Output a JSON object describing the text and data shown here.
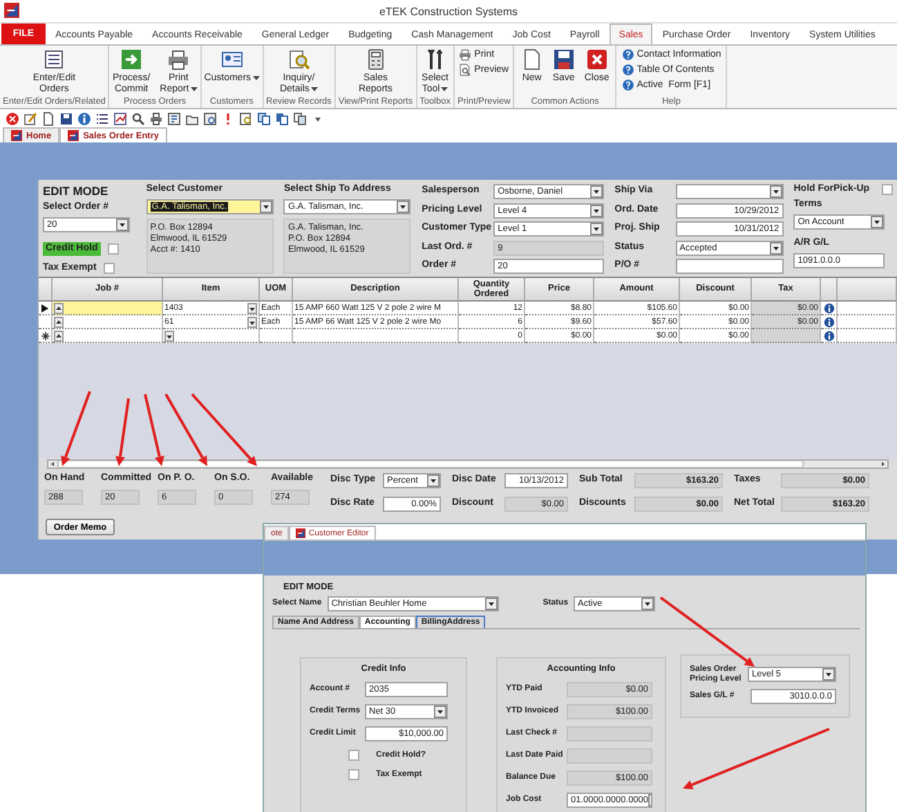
{
  "window": {
    "title": "eTEK Construction Systems"
  },
  "menu_tabs": [
    {
      "label": "FILE",
      "kind": "file",
      "selected": false
    },
    {
      "label": "Accounts Payable",
      "kind": "tab",
      "selected": false
    },
    {
      "label": "Accounts Receivable",
      "kind": "tab",
      "selected": false
    },
    {
      "label": "General Ledger",
      "kind": "tab",
      "selected": false
    },
    {
      "label": "Budgeting",
      "kind": "tab",
      "selected": false
    },
    {
      "label": "Cash Management",
      "kind": "tab",
      "selected": false
    },
    {
      "label": "Job Cost",
      "kind": "tab",
      "selected": false
    },
    {
      "label": "Payroll",
      "kind": "tab",
      "selected": false
    },
    {
      "label": "Sales",
      "kind": "tab",
      "selected": true
    },
    {
      "label": "Purchase Order",
      "kind": "tab",
      "selected": false
    },
    {
      "label": "Inventory",
      "kind": "tab",
      "selected": false
    },
    {
      "label": "System Utilities",
      "kind": "tab",
      "selected": false
    }
  ],
  "ribbon_groups": [
    {
      "label": "Enter/Edit Orders/Related",
      "buttons": [
        {
          "label": "Enter/Edit\nOrders",
          "kind": "large",
          "dropdown": false
        }
      ]
    },
    {
      "label": "Process Orders",
      "buttons": [
        {
          "label": "Process/\nCommit",
          "kind": "large",
          "dropdown": false
        },
        {
          "label": "Print\nReport",
          "kind": "large",
          "dropdown": true
        }
      ]
    },
    {
      "label": "Customers",
      "buttons": [
        {
          "label": "Customers",
          "kind": "large",
          "dropdown": true
        }
      ]
    },
    {
      "label": "Review Records",
      "buttons": [
        {
          "label": "Inquiry/\nDetails",
          "kind": "large",
          "dropdown": true
        }
      ]
    },
    {
      "label": "View/Print Reports",
      "buttons": [
        {
          "label": "Sales\nReports",
          "kind": "large",
          "dropdown": false
        }
      ]
    },
    {
      "label": "Toolbox",
      "buttons": [
        {
          "label": "Select\nTool",
          "kind": "large",
          "dropdown": true
        }
      ]
    },
    {
      "label": "Print/Preview",
      "buttons": [
        {
          "label": "Print",
          "kind": "small"
        },
        {
          "label": "Preview",
          "kind": "small"
        }
      ]
    },
    {
      "label": "Common Actions",
      "buttons": [
        {
          "label": "New",
          "kind": "large",
          "dropdown": false
        },
        {
          "label": "Save",
          "kind": "large",
          "dropdown": false
        },
        {
          "label": "Close",
          "kind": "large",
          "dropdown": false
        }
      ]
    },
    {
      "label": "Help",
      "buttons": [
        {
          "label": "Contact Information",
          "kind": "small"
        },
        {
          "label": "Table Of Contents",
          "kind": "small"
        },
        {
          "label": "Active  Form [F1]",
          "kind": "small"
        }
      ]
    }
  ],
  "doc_tabs": [
    {
      "label": "Home",
      "selected": false
    },
    {
      "label": "Sales Order Entry",
      "selected": true
    }
  ],
  "order_form": {
    "mode": "EDIT MODE",
    "select_order": {
      "label": "Select Order #",
      "value": "20",
      "kind": "dropdown"
    },
    "credit_hold": {
      "label": "Credit Hold",
      "checked": false
    },
    "tax_exempt": {
      "label": "Tax Exempt",
      "checked": false
    },
    "customer": {
      "label": "Select Customer",
      "value": "G.A. Talisman, Inc.",
      "address": [
        "P.O. Box 12894",
        "Elmwood, IL  61529",
        "Acct #: 1410"
      ]
    },
    "ship_to": {
      "label": "Select Ship To Address",
      "value": "G.A. Talisman, Inc.",
      "kind": "dropdown",
      "address": [
        "G.A. Talisman, Inc.",
        "P.O. Box 12894",
        "Elmwood, IL  61529"
      ]
    },
    "order_fields": [
      {
        "label": "Salesperson",
        "value": "Osborne, Daniel",
        "kind": "dropdown"
      },
      {
        "label": "Pricing Level",
        "value": "Level 4",
        "kind": "dropdown"
      },
      {
        "label": "Customer Type",
        "value": "Level 1",
        "kind": "dropdown"
      },
      {
        "label": "Last Ord. #",
        "value": "9",
        "kind": "readonly"
      },
      {
        "label": "Order #",
        "value": "20",
        "kind": "text"
      }
    ],
    "ship_fields": [
      {
        "label": "Ship Via",
        "kind": "dropdown"
      },
      {
        "label": "Ord. Date",
        "value": "10/29/2012",
        "kind": "number"
      },
      {
        "label": "Proj. Ship",
        "value": "10/31/2012",
        "kind": "number"
      },
      {
        "label": "Status",
        "value": "Accepted",
        "kind": "dropdown"
      },
      {
        "label": "P/O #",
        "kind": "text"
      }
    ],
    "hold_pickup": {
      "label": "Hold ForPick-Up",
      "checked": false
    },
    "terms": {
      "label": "Terms",
      "value": "On Account",
      "kind": "dropdown"
    },
    "ar_gl": {
      "label": "A/R G/L",
      "value": "1091.0.0.0",
      "kind": "text"
    }
  },
  "grid": {
    "columns": [
      "Job #",
      "Item",
      "UOM",
      "Description",
      "Quantity\nOrdered",
      "Price",
      "Amount",
      "Discount",
      "Tax"
    ],
    "rows": [
      {
        "kind": "item",
        "selected": true,
        "item": "1403",
        "uom": "Each",
        "description": "15 AMP 660 Watt 125 V 2 pole 2 wire M",
        "quantity": "12",
        "price": "$8.80",
        "amount": "$105.60",
        "discount": "$0.00",
        "tax": "$0.00"
      },
      {
        "kind": "item",
        "selected": false,
        "item": "61",
        "uom": "Each",
        "description": "15 AMP 66 Watt 125 V 2 pole 2 wire Mo",
        "quantity": "6",
        "price": "$9.60",
        "amount": "$57.60",
        "discount": "$0.00",
        "tax": "$0.00"
      },
      {
        "kind": "new",
        "selected": false,
        "quantity": "0",
        "price": "$0.00",
        "amount": "$0.00",
        "discount": "$0.00"
      }
    ]
  },
  "stock": [
    {
      "label": "On Hand",
      "value": "288"
    },
    {
      "label": "Committed",
      "value": "20"
    },
    {
      "label": "On P. O.",
      "value": "6"
    },
    {
      "label": "On S.O.",
      "value": "0"
    },
    {
      "label": "Available",
      "value": "274"
    }
  ],
  "discount_fields": [
    {
      "label": "Disc Type",
      "value": "Percent",
      "kind": "dropdown"
    },
    {
      "label": "Disc Rate",
      "value": "0.00%",
      "kind": "number"
    },
    {
      "label": "Disc Date",
      "value": "10/13/2012",
      "kind": "number"
    },
    {
      "label": "Discount",
      "value": "$0.00",
      "kind": "readonly_number"
    }
  ],
  "totals": [
    {
      "label": "Sub Total",
      "value": "$163.20"
    },
    {
      "label": "Discounts",
      "value": "$0.00"
    },
    {
      "label": "Taxes",
      "value": "$0.00"
    },
    {
      "label": "Net Total",
      "value": "$163.20"
    }
  ],
  "order_memo_button": "Order Memo",
  "customer_editor": {
    "tabs": [
      {
        "label": "ote",
        "selected": false
      },
      {
        "label": "Customer Editor",
        "selected": true
      }
    ],
    "mode": "EDIT MODE",
    "select_name": {
      "label": "Select Name",
      "value": "Christian Beuhler Home",
      "kind": "dropdown"
    },
    "status": {
      "label": "Status",
      "value": "Active",
      "kind": "dropdown"
    },
    "sections": [
      {
        "label": "Name And Address",
        "selected": false
      },
      {
        "label": "Accounting",
        "selected": true
      },
      {
        "label": "BillingAddress",
        "selected": false
      }
    ],
    "credit_info": {
      "title": "Credit Info",
      "fields": [
        {
          "label": "Account #",
          "value": "2035",
          "kind": "text"
        },
        {
          "label": "Credit Terms",
          "value": "Net 30",
          "kind": "dropdown"
        },
        {
          "label": "Credit Limit",
          "value": "$10,000.00",
          "kind": "number"
        }
      ],
      "checks": [
        {
          "label": "Credit Hold?",
          "checked": false
        },
        {
          "label": "Tax Exempt",
          "checked": false
        }
      ]
    },
    "accounting_info": {
      "title": "Accounting Info",
      "fields": [
        {
          "label": "YTD Paid",
          "value": "$0.00",
          "kind": "readonly_number"
        },
        {
          "label": "YTD Invoiced",
          "value": "$100.00",
          "kind": "readonly_number"
        },
        {
          "label": "Last Check #",
          "kind": "readonly"
        },
        {
          "label": "Last Date Paid",
          "kind": "readonly"
        },
        {
          "label": "Balance Due",
          "value": "$100.00",
          "kind": "readonly_number"
        },
        {
          "label": "Job Cost",
          "value": "01.0000.0000.0000",
          "kind": "dropdown"
        }
      ]
    },
    "pricing": {
      "fields": [
        {
          "label": "Sales Order\nPricing Level",
          "value": "Level 5",
          "kind": "dropdown"
        },
        {
          "label": "Sales G/L #",
          "value": "3010.0.0.0",
          "kind": "number"
        }
      ]
    }
  }
}
